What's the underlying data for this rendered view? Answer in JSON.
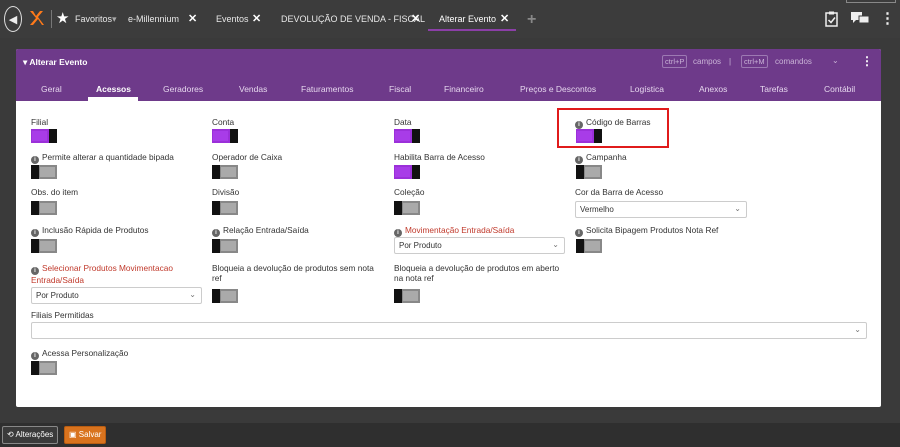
{
  "topbar": {
    "tabs": [
      {
        "label": "Favoritos"
      },
      {
        "label": "e-Millennium"
      },
      {
        "label": "Eventos"
      },
      {
        "label": "DEVOLUÇÃO DE VENDA - FISCAL"
      },
      {
        "label": "Alterar Evento"
      }
    ],
    "close_glyph": "✕"
  },
  "card": {
    "title": "Alterar Evento",
    "shortcut_campos_key": "ctrl+P",
    "shortcut_campos_label": "campos",
    "shortcut_comandos_key": "ctrl+M",
    "shortcut_comandos_label": "comandos",
    "separator": "|"
  },
  "subnav": [
    "Geral",
    "Acessos",
    "Geradores",
    "Vendas",
    "Faturamentos",
    "Fiscal",
    "Financeiro",
    "Preços e Descontos",
    "Logística",
    "Anexos",
    "Tarefas",
    "Contábil"
  ],
  "fields": {
    "filial": "Filial",
    "conta": "Conta",
    "data": "Data",
    "codigo_barras": "Código de Barras",
    "permite_alterar": "Permite alterar a quantidade bipada",
    "operador_caixa": "Operador de Caixa",
    "habilita_barra": "Habilita Barra de Acesso",
    "campanha": "Campanha",
    "obs_item": "Obs. do item",
    "divisao": "Divisão",
    "colecao": "Coleção",
    "cor_barra": "Cor da Barra de Acesso",
    "cor_barra_value": "Vermelho",
    "inclusao_rapida": "Inclusão Rápida de Produtos",
    "relacao_es": "Relação Entrada/Saída",
    "movimentacao_es": "Movimentação Entrada/Saída",
    "movimentacao_es_value": "Por Produto",
    "solicita_bipagem": "Solicita Bipagem Produtos Nota Ref",
    "selecionar_produtos": "Selecionar Produtos Movimentacao Entrada/Saída",
    "selecionar_produtos_value": "Por Produto",
    "bloqueia_sem_nota": "Bloqueia a devolução de produtos sem nota ref",
    "bloqueia_em_aberto": "Bloqueia a devolução de produtos em aberto na nota ref",
    "filiais_permitidas": "Filiais Permitidas",
    "acessa_personalizacao": "Acessa Personalização"
  },
  "footer": {
    "alteracoes": "Alterações",
    "salvar": "Salvar"
  },
  "colors": {
    "accent": "#6e3a8a",
    "toggle_on": "#a83ce8",
    "highlight": "#e01b1b",
    "save": "#d9731e"
  }
}
